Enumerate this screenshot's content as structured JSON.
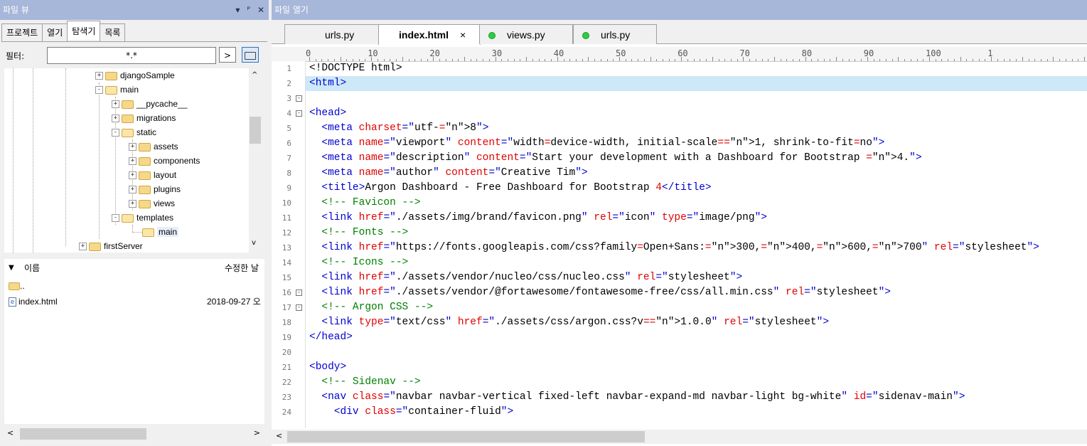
{
  "left_panel": {
    "title": "파일 뷰",
    "title_buttons": [
      "▾",
      "ᴾ",
      "✕"
    ],
    "tabs": [
      "프로젝트",
      "열기",
      "탐색기",
      "목록"
    ],
    "active_tab": "탐색기",
    "filter_label": "필터:",
    "filter_value": "*.*",
    "filter_go": ">",
    "tree": [
      {
        "label": "djangoSample"
      },
      {
        "label": "main"
      },
      {
        "label": "__pycache__"
      },
      {
        "label": "migrations"
      },
      {
        "label": "static"
      },
      {
        "label": "assets"
      },
      {
        "label": "components"
      },
      {
        "label": "layout"
      },
      {
        "label": "plugins"
      },
      {
        "label": "views"
      },
      {
        "label": "templates"
      },
      {
        "label": "main"
      },
      {
        "label": "firstServer"
      }
    ],
    "file_list": {
      "col_name": "이름",
      "col_modified": "수정한 날",
      "sort_arrow": "▼",
      "rows": [
        {
          "name": "..",
          "date": ""
        },
        {
          "name": "index.html",
          "date": "2018-09-27 오"
        }
      ]
    }
  },
  "right_panel": {
    "title": "파일 열기",
    "tabs": [
      {
        "label": "urls.py",
        "active": false,
        "dot": false
      },
      {
        "label": "index.html",
        "active": true,
        "dot": false,
        "close": "×"
      },
      {
        "label": "views.py",
        "active": false,
        "dot": true
      },
      {
        "label": "urls.py",
        "active": false,
        "dot": true
      }
    ],
    "ruler": [
      "0",
      "10",
      "20",
      "30",
      "40",
      "50",
      "60",
      "70",
      "80",
      "90",
      "100",
      "1"
    ],
    "line_numbers": [
      "1",
      "2",
      "3",
      "4",
      "5",
      "6",
      "7",
      "8",
      "9",
      "10",
      "11",
      "12",
      "13",
      "14",
      "15",
      "16",
      "17",
      "18",
      "19",
      "20",
      "21",
      "22",
      "23",
      "24"
    ],
    "fold_markers": {
      "3": "-",
      "4": "-",
      "16": "-",
      "17": "-"
    },
    "code": [
      "<!DOCTYPE html>",
      "<html>",
      "",
      "<head>",
      "  <meta charset=\"utf-8\">",
      "  <meta name=\"viewport\" content=\"width=device-width, initial-scale=1, shrink-to-fit=no\">",
      "  <meta name=\"description\" content=\"Start your development with a Dashboard for Bootstrap 4.\">",
      "  <meta name=\"author\" content=\"Creative Tim\">",
      "  <title>Argon Dashboard - Free Dashboard for Bootstrap 4</title>",
      "  <!-- Favicon -->",
      "  <link href=\"./assets/img/brand/favicon.png\" rel=\"icon\" type=\"image/png\">",
      "  <!-- Fonts -->",
      "  <link href=\"https://fonts.googleapis.com/css?family=Open+Sans:300,400,600,700\" rel=\"stylesheet\">",
      "  <!-- Icons -->",
      "  <link href=\"./assets/vendor/nucleo/css/nucleo.css\" rel=\"stylesheet\">",
      "  <link href=\"./assets/vendor/@fortawesome/fontawesome-free/css/all.min.css\" rel=\"stylesheet\">",
      "  <!-- Argon CSS -->",
      "  <link type=\"text/css\" href=\"./assets/css/argon.css?v=1.0.0\" rel=\"stylesheet\">",
      "</head>",
      "",
      "<body>",
      "  <!-- Sidenav -->",
      "  <nav class=\"navbar navbar-vertical fixed-left navbar-expand-md navbar-light bg-white\" id=\"sidenav-main\">",
      "    <div class=\"container-fluid\">"
    ],
    "highlighted_line": 2
  },
  "colors": {
    "titlebar": "#a7b7d9",
    "tag": "#0000d0",
    "attr": "#e00000",
    "comment": "#008000",
    "highlight": "#cde8f7"
  }
}
